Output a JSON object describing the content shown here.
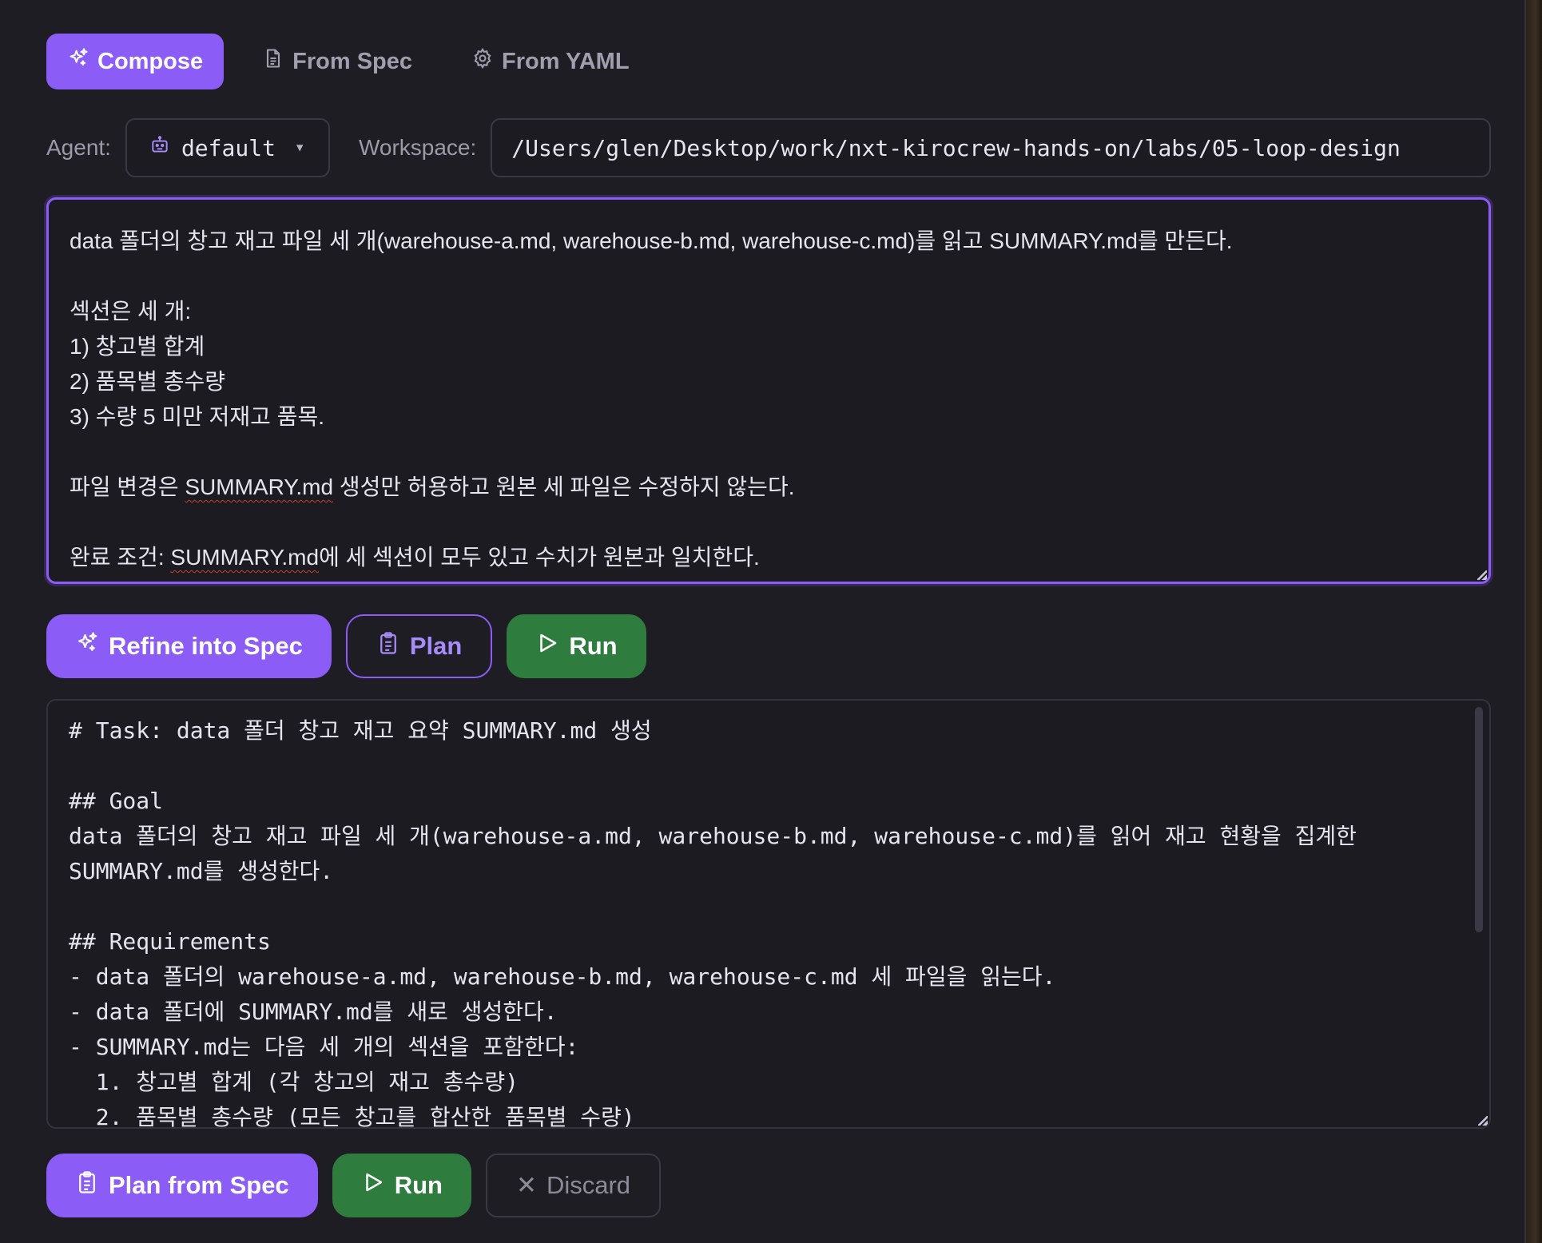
{
  "tabs": [
    {
      "label": "Compose",
      "icon": "sparkles-icon",
      "active": true
    },
    {
      "label": "From Spec",
      "icon": "document-icon",
      "active": false
    },
    {
      "label": "From YAML",
      "icon": "gear-icon",
      "active": false
    }
  ],
  "agent": {
    "label": "Agent:",
    "value": "default",
    "caret": "▼"
  },
  "workspace": {
    "label": "Workspace:",
    "value": "/Users/glen/Desktop/work/nxt-kirocrew-hands-on/labs/05-loop-design"
  },
  "compose": {
    "lines": [
      "data 폴더의 창고 재고 파일 세 개(warehouse-a.md, warehouse-b.md, warehouse-c.md)를 읽고 SUMMARY.md를 만든다.",
      "",
      "섹션은 세 개:",
      "1) 창고별 합계",
      "2) 품목별 총수량",
      "3) 수량 5 미만 저재고 품목.",
      "",
      "파일 변경은 ",
      "",
      "완료 조건: "
    ],
    "line8_prefix": "파일 변경은 ",
    "line8_flag": "SUMMARY.md",
    "line8_suffix": " 생성만 허용하고 원본 세 파일은 수정하지 않는다.",
    "line10_prefix": "완료 조건: ",
    "line10_flag": "SUMMARY.md",
    "line10_suffix": "에 세 섹션이 모두 있고 수치가 원본과 일치한다."
  },
  "actions_top": {
    "refine": "Refine into Spec",
    "plan": "Plan",
    "run": "Run"
  },
  "spec": {
    "lines": [
      "# Task: data 폴더 창고 재고 요약 SUMMARY.md 생성",
      "",
      "## Goal",
      "data 폴더의 창고 재고 파일 세 개(warehouse-a.md, warehouse-b.md, warehouse-c.md)를 읽어 재고 현황을 집계한",
      "SUMMARY.md를 생성한다.",
      "",
      "## Requirements",
      "- data 폴더의 warehouse-a.md, warehouse-b.md, warehouse-c.md 세 파일을 읽는다.",
      "- data 폴더에 SUMMARY.md를 새로 생성한다.",
      "- SUMMARY.md는 다음 세 개의 섹션을 포함한다:",
      "  1. 창고별 합계 (각 창고의 재고 총수량)",
      "  2. 품목별 총수량 (모든 창고를 합산한 품목별 수량)"
    ]
  },
  "actions_bottom": {
    "plan_from_spec": "Plan from Spec",
    "run": "Run",
    "discard": "Discard",
    "discard_glyph": "✕"
  },
  "colors": {
    "accent": "#8b5cf6",
    "run_green": "#2f7d3e",
    "background": "#1e1d24"
  }
}
